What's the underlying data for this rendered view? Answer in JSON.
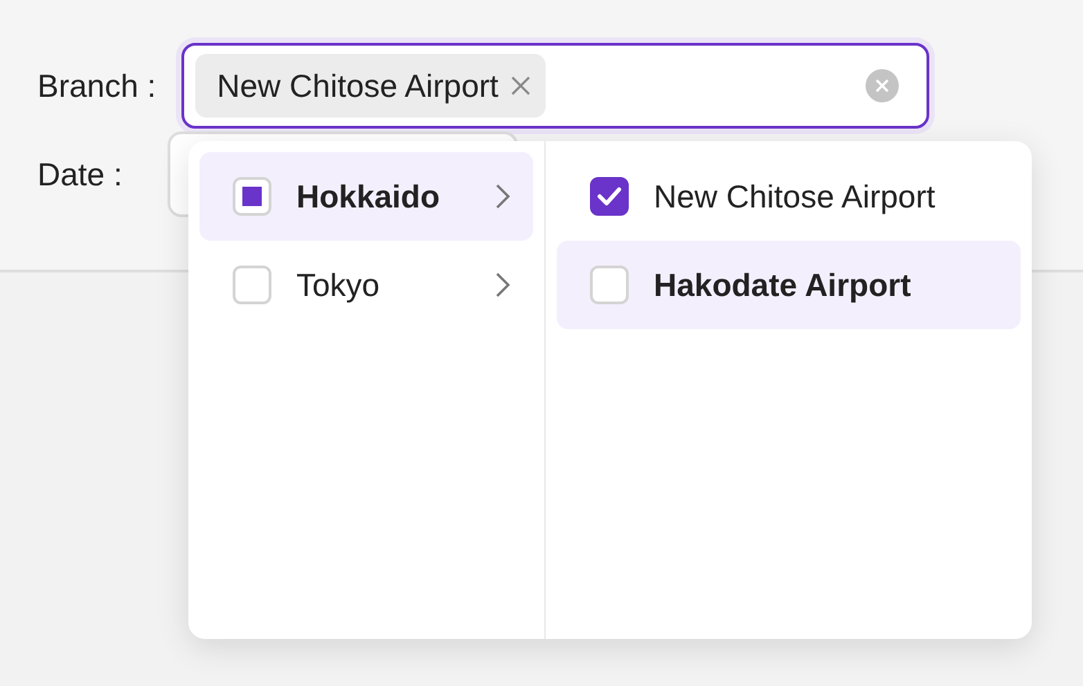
{
  "form": {
    "branch_label": "Branch :",
    "date_label": "Date :"
  },
  "branch_field": {
    "tags": [
      {
        "label": "New Chitose Airport"
      }
    ],
    "focused": true
  },
  "dropdown": {
    "regions": [
      {
        "label": "Hokkaido",
        "checked": false,
        "indeterminate": true,
        "selected": true
      },
      {
        "label": "Tokyo",
        "checked": false,
        "indeterminate": false,
        "selected": false
      }
    ],
    "branches": [
      {
        "label": "New Chitose Airport",
        "checked": true,
        "active": false
      },
      {
        "label": "Hakodate Airport",
        "checked": false,
        "active": true
      }
    ]
  }
}
